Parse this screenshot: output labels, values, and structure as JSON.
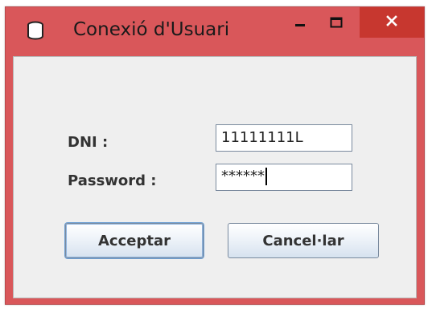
{
  "window": {
    "title": "Conexió d'Usuari",
    "icon": "database-icon",
    "controls": {
      "minimize": "minimize-icon",
      "maximize": "maximize-icon",
      "close": "close-icon"
    },
    "colors": {
      "frame": "#d9575a",
      "close_button": "#c7372f",
      "client": "#efefef"
    }
  },
  "form": {
    "dni_label": "DNI :",
    "dni_value": "11111111L",
    "password_label": "Password :",
    "password_value": "******"
  },
  "buttons": {
    "accept_label": "Acceptar",
    "cancel_label": "Cancel·lar"
  }
}
